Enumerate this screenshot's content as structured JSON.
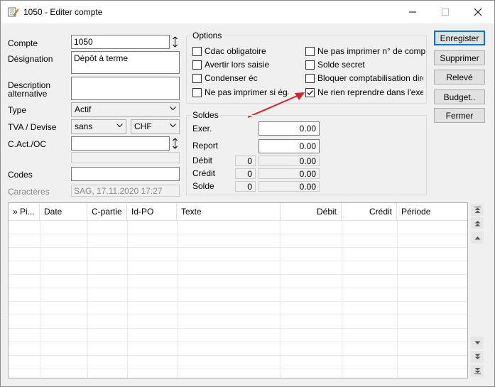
{
  "window": {
    "title": "1050 - Editer compte",
    "icon": "notepad-edit-icon",
    "controls": [
      "minimize-icon",
      "maximize-icon",
      "close-icon"
    ]
  },
  "form": {
    "compte": {
      "label": "Compte",
      "value": "1050"
    },
    "designation": {
      "label": "Désignation",
      "value": "Dépôt à terme"
    },
    "description": {
      "label_line1": "Description",
      "label_line2": "alternative",
      "value": ""
    },
    "type": {
      "label": "Type",
      "value": "Actif"
    },
    "tva": {
      "label": "TVA / Devise",
      "value": "sans",
      "devise": "CHF"
    },
    "cact": {
      "label": "C.Act./OC",
      "value": "",
      "value2": ""
    },
    "codes": {
      "label": "Codes",
      "value": ""
    },
    "caracteres": {
      "label": "Caractères",
      "value": "SAG, 17.11.2020 17:27"
    }
  },
  "options": {
    "title": "Options",
    "items": [
      {
        "label": "Cdac obligatoire",
        "checked": false
      },
      {
        "label": "Avertir lors saisie",
        "checked": false
      },
      {
        "label": "Condenser éc",
        "checked": false
      },
      {
        "label": "Ne pas imprimer si égal zé",
        "checked": false
      },
      {
        "label": "Ne pas imprimer n° de comp",
        "checked": false
      },
      {
        "label": "Solde secret",
        "checked": false
      },
      {
        "label": "Bloquer comptabilisation directe",
        "checked": false
      },
      {
        "label": "Ne rien reprendre dans l'exercic",
        "checked": true
      }
    ]
  },
  "soldes": {
    "title": "Soldes",
    "exer": {
      "label": "Exer.",
      "value": "0.00"
    },
    "report": {
      "label": "Report",
      "value": "0.00"
    },
    "debit": {
      "label": "Débit",
      "count": "0",
      "value": "0.00"
    },
    "credit": {
      "label": "Crédit",
      "count": "0",
      "value": "0.00"
    },
    "solde": {
      "label": "Solde",
      "count": "0",
      "value": "0.00"
    }
  },
  "buttons": {
    "enregistrer": "Enregister",
    "supprimer": "Supprimer",
    "releve": "Relevé",
    "budget": "Budget..",
    "fermer": "Fermer"
  },
  "grid": {
    "columns": [
      "» Pi...",
      "Date",
      "C-partie",
      "Id-PO",
      "Texte",
      "Débit",
      "Crédit",
      "Période"
    ],
    "rows": []
  },
  "colors": {
    "accent": "#0078d7",
    "arrow": "#e02020"
  }
}
